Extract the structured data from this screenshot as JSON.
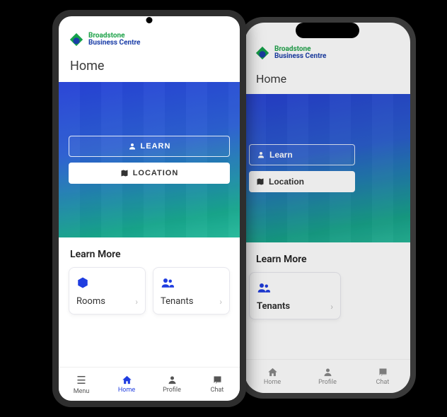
{
  "brand": {
    "line1": "Broadstone",
    "line2": "Business Centre"
  },
  "page": {
    "title": "Home"
  },
  "hero": {
    "learn_label": "LEARN",
    "location_label": "LOCATION",
    "learn_label_back": "Learn",
    "location_label_back": "Location"
  },
  "learn_more": {
    "title": "Learn More"
  },
  "cards": {
    "rooms": {
      "label": "Rooms"
    },
    "tenants": {
      "label": "Tenants"
    }
  },
  "nav": {
    "menu": "Menu",
    "home": "Home",
    "profile": "Profile",
    "chat": "Chat"
  }
}
